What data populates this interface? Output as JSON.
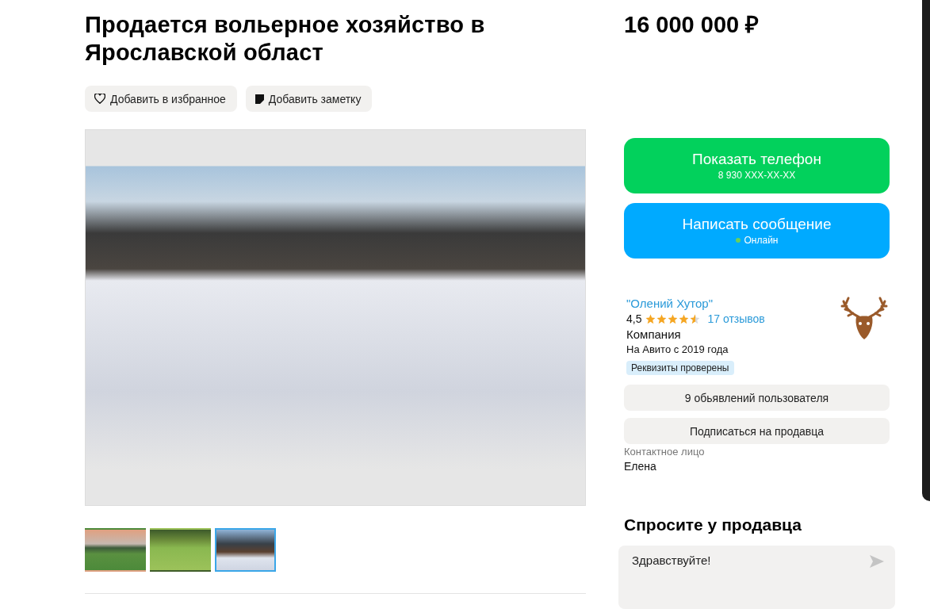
{
  "title": "Продается вольерное хозяйство в Ярославской област",
  "actions": [
    {
      "kind": "favorite",
      "label": "Добавить в избранное"
    },
    {
      "kind": "note",
      "label": "Добавить заметку"
    }
  ],
  "gallery": {
    "thumbnails": [
      {
        "kind": "sunset-field",
        "selected": false
      },
      {
        "kind": "deer-grass",
        "selected": false
      },
      {
        "kind": "deer-snow",
        "selected": true
      }
    ]
  },
  "price": "16 000 000 ₽",
  "contact_buttons": [
    {
      "kind": "phone",
      "label": "Показать телефон",
      "sub": "8 930 XXX-XX-XX"
    },
    {
      "kind": "message",
      "label": "Написать сообщение",
      "sub": "Онлайн",
      "online": true
    }
  ],
  "seller": {
    "name": "\"Олений Хутор\"",
    "rating": "4,5",
    "stars": 4.5,
    "reviews": "17 отзывов",
    "type": "Компания",
    "since": "На Авито с 2019 года",
    "badge": "Реквизиты проверены",
    "buttons": [
      "9 обьявлений пользователя",
      "Подписаться на продавца"
    ],
    "contact_label": "Контактное лицо",
    "contact_name": "Елена"
  },
  "ask": {
    "heading": "Спросите у продавца",
    "value": "Здравствуйте!"
  }
}
